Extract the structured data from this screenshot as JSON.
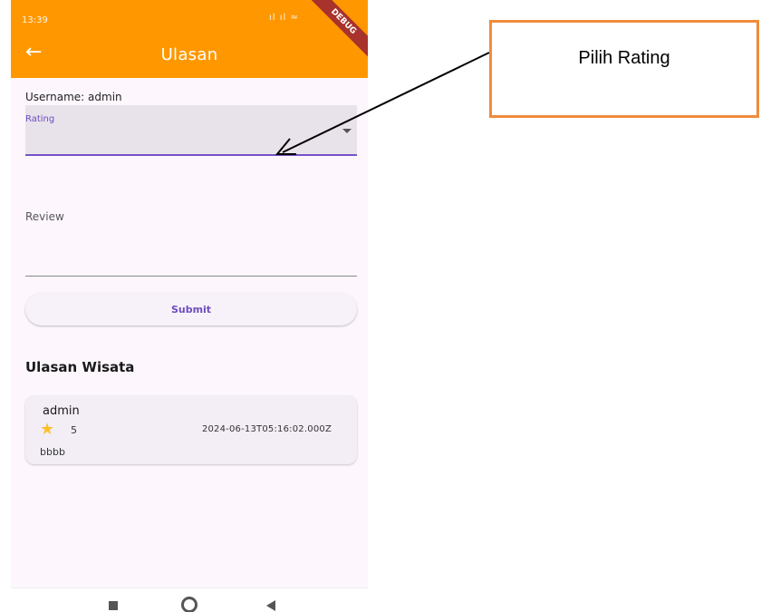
{
  "status_bar": {
    "time": "13:39",
    "icons": "ıl ıl ≈",
    "debug_banner": "DEBUG"
  },
  "app_bar": {
    "back_icon": "arrow-left-icon",
    "title": "Ulasan",
    "color": "#ff9800"
  },
  "form": {
    "username_text": "Username: admin",
    "rating_label": "Rating",
    "review_label": "Review",
    "submit_label": "Submit",
    "accent_color": "#6f4cbf"
  },
  "reviews": {
    "title": "Ulasan Wisata",
    "items": [
      {
        "user": "admin",
        "rating": "5",
        "date": "2024-06-13T05:16:02.000Z",
        "text": "bbbb",
        "icon": "star-icon"
      }
    ]
  },
  "annotation": {
    "text": "Pilih Rating",
    "border_color": "#f08c3c"
  }
}
